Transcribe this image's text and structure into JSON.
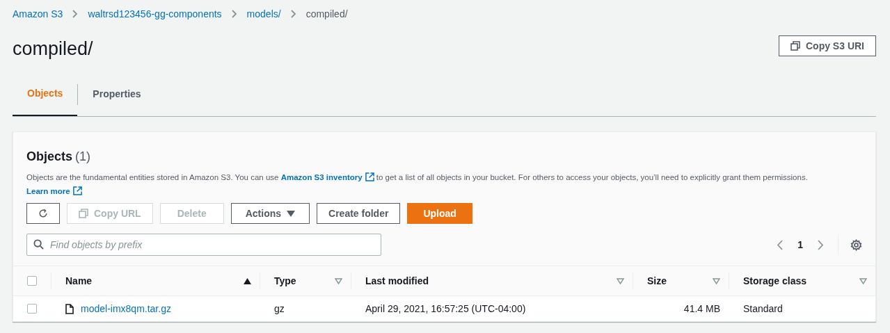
{
  "breadcrumbs": [
    {
      "label": "Amazon S3",
      "current": false
    },
    {
      "label": "waltrsd123456-gg-components",
      "current": false
    },
    {
      "label": "models/",
      "current": false
    },
    {
      "label": "compiled/",
      "current": true
    }
  ],
  "title": "compiled/",
  "copy_uri_button": "Copy S3 URI",
  "tabs": [
    {
      "label": "Objects",
      "selected": true
    },
    {
      "label": "Properties",
      "selected": false
    }
  ],
  "objects": {
    "heading": "Objects",
    "count": "(1)",
    "description": [
      {
        "kind": "text",
        "text": "Objects are the fundamental entities stored in Amazon S3. You can use "
      },
      {
        "kind": "link",
        "text": "Amazon S3 inventory"
      },
      {
        "kind": "text",
        "text": " to get a list of all objects in your bucket. For others to access your objects, you’ll need to explicitly grant them permissions. "
      },
      {
        "kind": "link",
        "text": "Learn more"
      }
    ],
    "buttons": [
      {
        "kind": "refresh",
        "disabled": false
      },
      {
        "kind": "copy",
        "label": "Copy URL",
        "disabled": true
      },
      {
        "kind": "plain",
        "label": "Delete",
        "disabled": true
      },
      {
        "kind": "dropdown",
        "label": "Actions",
        "disabled": false
      },
      {
        "kind": "plain",
        "label": "Create folder",
        "disabled": false
      },
      {
        "kind": "primary",
        "label": "Upload",
        "disabled": false
      }
    ],
    "search": {
      "placeholder": "Find objects by prefix"
    },
    "page": "1",
    "table": {
      "select_all_checked": false,
      "columns": [
        {
          "label": "Name",
          "sorted": true
        },
        {
          "label": "Type",
          "sorted": false
        },
        {
          "label": "Last modified",
          "sorted": false
        },
        {
          "label": "Size",
          "sorted": false
        },
        {
          "label": "Storage class",
          "sorted": false
        }
      ],
      "rows": [
        {
          "checked": false,
          "name": "model-imx8qm.tar.gz",
          "type": "gz",
          "last_modified": "April 29, 2021, 16:57:25 (UTC-04:00)",
          "size": "41.4 MB",
          "storage_class": "Standard"
        }
      ]
    }
  }
}
